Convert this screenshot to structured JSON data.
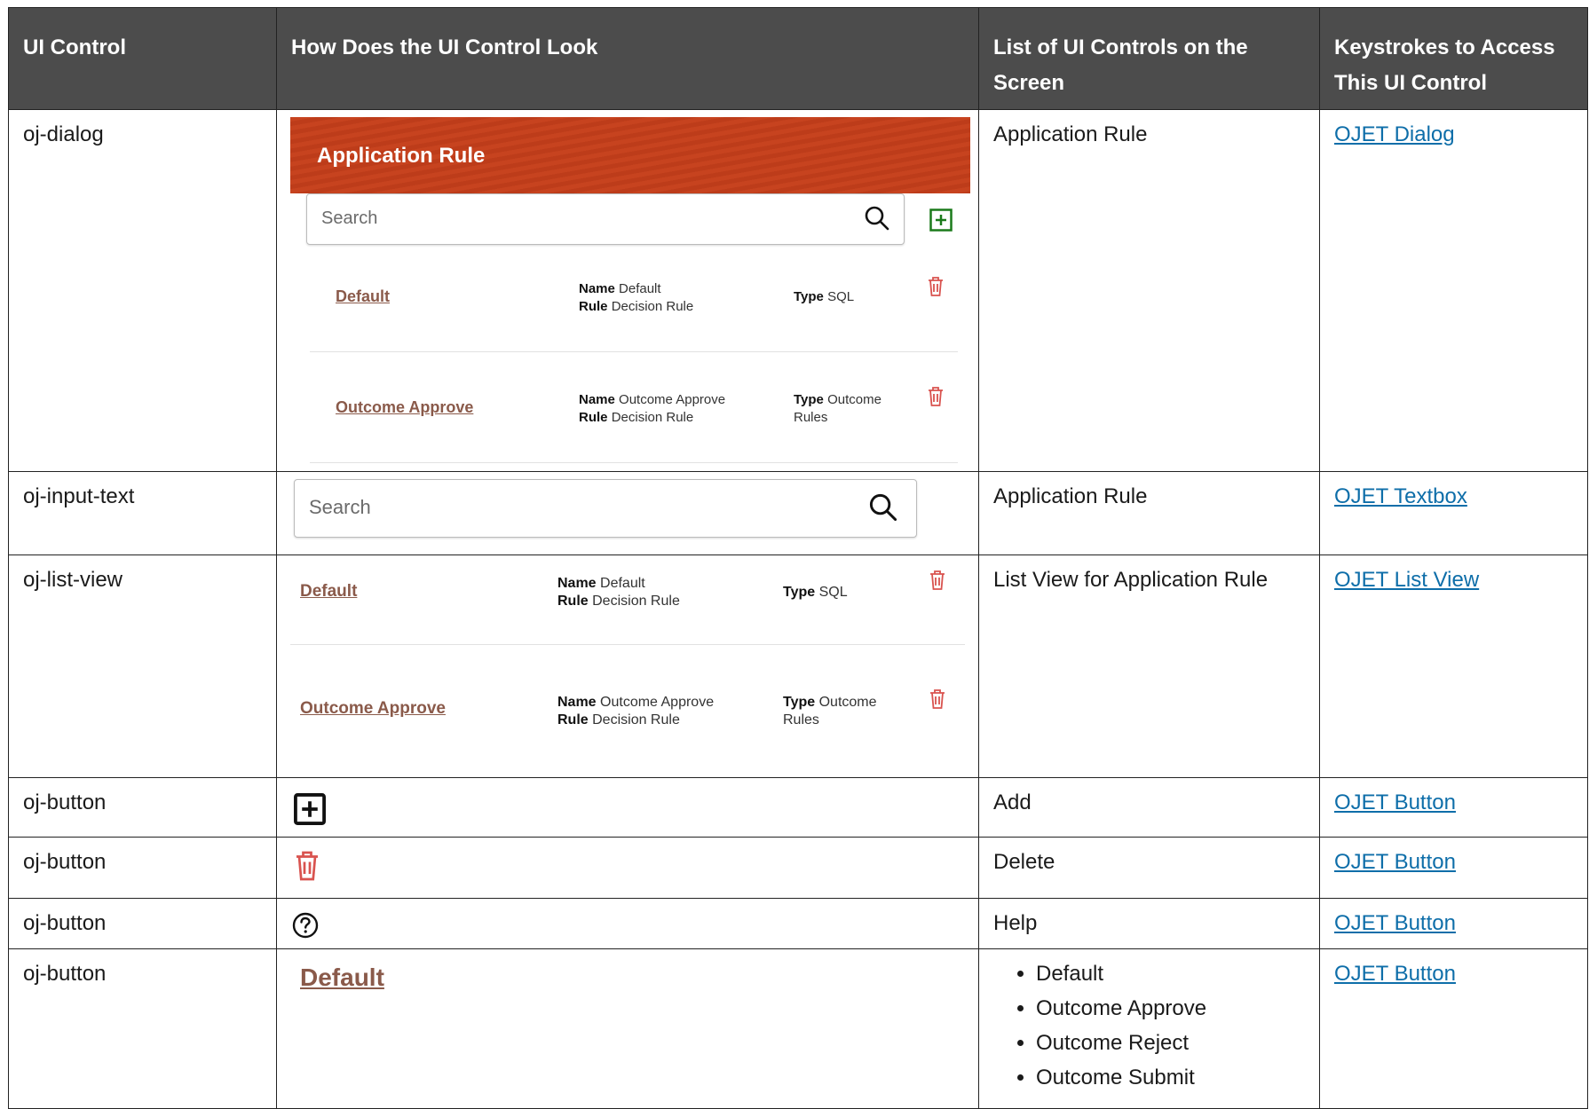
{
  "headers": [
    "UI Control",
    "How Does the UI Control Look",
    "List of UI Controls on the Screen",
    "Keystrokes to Access This UI Control"
  ],
  "rows": [
    {
      "control": "oj-dialog",
      "screen": "Application Rule",
      "keystroke": "OJET Dialog"
    },
    {
      "control": "oj-input-text",
      "screen": "Application Rule",
      "keystroke": "OJET Textbox"
    },
    {
      "control": "oj-list-view",
      "screen": "List View for Application Rule",
      "keystroke": "OJET List View"
    },
    {
      "control": "oj-button",
      "screen": "Add",
      "keystroke": "OJET Button"
    },
    {
      "control": "oj-button",
      "screen": "Delete",
      "keystroke": "OJET Button"
    },
    {
      "control": "oj-button",
      "screen": "Help",
      "keystroke": "OJET Button"
    },
    {
      "control": "oj-button",
      "screen_list": [
        "Default",
        "Outcome Approve",
        "Outcome Reject",
        "Outcome Submit"
      ],
      "keystroke": "OJET Button"
    }
  ],
  "preview": {
    "dialog_title": "Application Rule",
    "search_placeholder": "Search",
    "items": [
      {
        "link": "Default",
        "name_label": "Name",
        "name_value": "Default",
        "rule_label": "Rule",
        "rule_value": "Decision Rule",
        "type_label": "Type",
        "type_value": "SQL",
        "type_value2": ""
      },
      {
        "link": "Outcome Approve",
        "name_label": "Name",
        "name_value": "Outcome Approve",
        "rule_label": "Rule",
        "rule_value": "Decision Rule",
        "type_label": "Type",
        "type_value": "Outcome",
        "type_value2": "Rules"
      }
    ],
    "default_link": "Default"
  },
  "colors": {
    "header_bg": "#4c4c4c",
    "link": "#0e6ea9",
    "dialog_header": "#c7431f",
    "trash": "#c0392b",
    "add_icon": "#1a7a1a"
  }
}
